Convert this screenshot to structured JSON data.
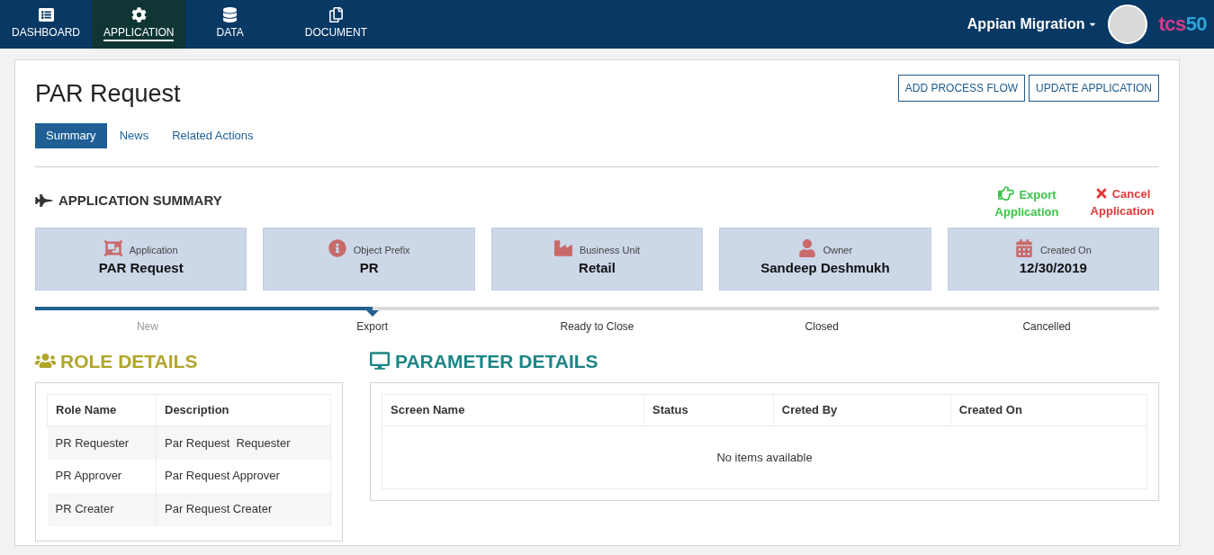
{
  "nav": {
    "items": [
      {
        "label": "DASHBOARD",
        "kind": "dashboard",
        "selected": false
      },
      {
        "label": "APPLICATION",
        "kind": "application",
        "selected": true
      },
      {
        "label": "DATA",
        "kind": "data",
        "selected": false
      },
      {
        "label": "DOCUMENT",
        "kind": "document",
        "selected": false
      }
    ],
    "user": "Appian Migration",
    "logo": {
      "letters": "tcs",
      "number": "50"
    }
  },
  "page": {
    "title": "PAR Request",
    "buttons": [
      "ADD PROCESS FLOW",
      "UPDATE APPLICATION"
    ],
    "tabs": [
      {
        "label": "Summary",
        "selected": true
      },
      {
        "label": "News",
        "selected": false
      },
      {
        "label": "Related Actions",
        "selected": false
      }
    ]
  },
  "summary": {
    "heading": "APPLICATION SUMMARY",
    "actions": [
      {
        "label": "Export Application",
        "kind": "export"
      },
      {
        "label": "Cancel Application",
        "kind": "cancel"
      }
    ],
    "cards": [
      {
        "kind": "application",
        "label": "Application",
        "value": "PAR Request"
      },
      {
        "kind": "prefix",
        "label": "Object Prefix",
        "value": "PR"
      },
      {
        "kind": "unit",
        "label": "Business Unit",
        "value": "Retail"
      },
      {
        "kind": "owner",
        "label": "Owner",
        "value": "Sandeep Deshmukh"
      },
      {
        "kind": "date",
        "label": "Created On",
        "value": "12/30/2019"
      }
    ],
    "progress": {
      "level": 0.3,
      "steps": [
        {
          "label": "New",
          "selected": false,
          "done": true
        },
        {
          "label": "Export",
          "selected": true,
          "done": false
        },
        {
          "label": "Ready to Close",
          "selected": false,
          "done": false
        },
        {
          "label": "Closed",
          "selected": false,
          "done": false
        },
        {
          "label": "Cancelled",
          "selected": false,
          "done": false
        }
      ]
    }
  },
  "roles": {
    "heading": "ROLE DETAILS",
    "columns": [
      "Role Name",
      "Description"
    ],
    "rows": [
      [
        "PR Requester",
        "Par Request  Requester"
      ],
      [
        "PR Approver",
        "Par Request Approver"
      ],
      [
        "PR Creater",
        "Par Request Creater"
      ]
    ]
  },
  "parameters": {
    "heading": "PARAMETER DETAILS",
    "columns": [
      "Screen Name",
      "Status",
      "Creted By",
      "Created On"
    ],
    "empty": "No items available"
  }
}
